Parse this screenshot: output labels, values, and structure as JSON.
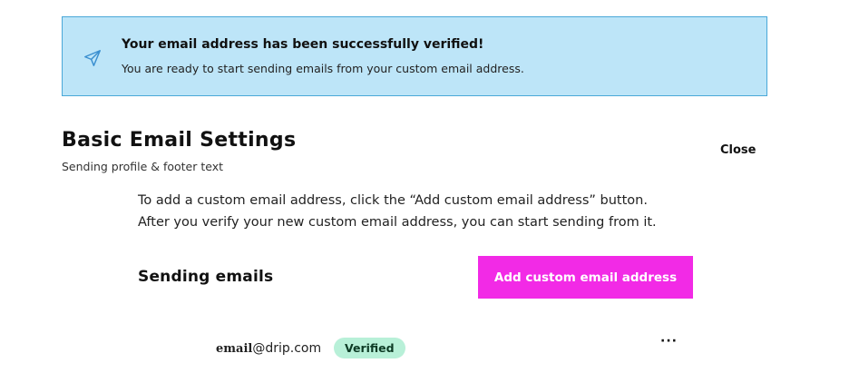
{
  "banner": {
    "title": "Your email address has been successfully verified!",
    "message": "You are ready to start sending emails from your custom email address.",
    "icon": "paper-plane-icon",
    "bg_color": "#bde5f8",
    "border_color": "#4aa8d8"
  },
  "settings": {
    "title": "Basic Email Settings",
    "subtitle": "Sending profile & footer text",
    "close_label": "Close",
    "instructions": "To add a custom email address, click the “Add custom email address” button. After you verify your new custom email address, you can start sending from it."
  },
  "sending": {
    "heading": "Sending emails",
    "add_button_label": "Add custom email address",
    "add_button_color": "#f22ae6",
    "emails": [
      {
        "local": "email",
        "domain": "@drip.com",
        "status": "Verified",
        "status_color": "#b8f0d8",
        "menu_label": "···"
      }
    ]
  }
}
